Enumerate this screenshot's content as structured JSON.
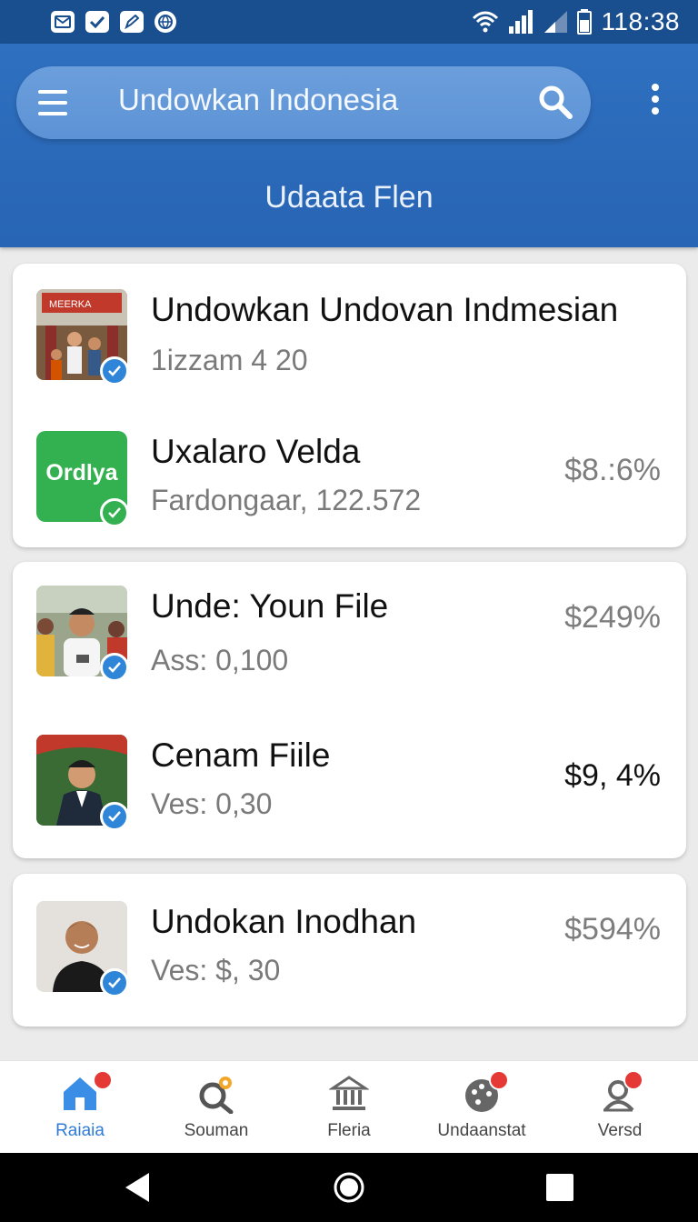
{
  "status_bar": {
    "time": "118:38",
    "notification_icons": [
      "mail-icon",
      "check-icon",
      "edit-icon",
      "globe-icon"
    ],
    "indicator_icons": [
      "wifi-icon",
      "signal-icon",
      "signal-weak-icon",
      "battery-icon"
    ]
  },
  "header": {
    "search_text": "Undowkan Indonesia",
    "subtitle": "Udaata Flen",
    "accent_color": "#2f70c0"
  },
  "cards": [
    {
      "rows": [
        {
          "title": "Undowkan Undovan Indmesian",
          "subtitle": "1izzam 4 20",
          "value": "",
          "thumb": "market-stall-photo"
        },
        {
          "title": "Uxalaro Velda",
          "subtitle": "Fardongaar, 122.572",
          "value": "$8.:6%",
          "thumb": "green-logo",
          "logo_text": "Ordlya"
        }
      ]
    },
    {
      "rows": [
        {
          "title": "Unde: Youn File",
          "subtitle": "Ass: 0,100",
          "value": "$249%",
          "thumb": "man-in-crowd-photo"
        },
        {
          "title": "Cenam Fiile",
          "subtitle": "Ves: 0,30",
          "value": "$9, 4%",
          "thumb": "man-in-suit-photo"
        }
      ]
    },
    {
      "rows": [
        {
          "title": "Undokan Inodhan",
          "subtitle": "Ves: $, 30",
          "value": "$594%",
          "thumb": "portrait-photo"
        }
      ]
    }
  ],
  "bottom_nav": [
    {
      "label": "Raiaia",
      "icon": "home-icon",
      "active": true,
      "badge": true
    },
    {
      "label": "Souman",
      "icon": "search-gear-icon",
      "active": false,
      "badge": false
    },
    {
      "label": "Fleria",
      "icon": "bank-icon",
      "active": false,
      "badge": false
    },
    {
      "label": "Undaanstat",
      "icon": "palette-icon",
      "active": false,
      "badge": true
    },
    {
      "label": "Versd",
      "icon": "profile-icon",
      "active": false,
      "badge": true
    }
  ],
  "system_nav": [
    "back-icon",
    "home-circle-icon",
    "recents-icon"
  ]
}
